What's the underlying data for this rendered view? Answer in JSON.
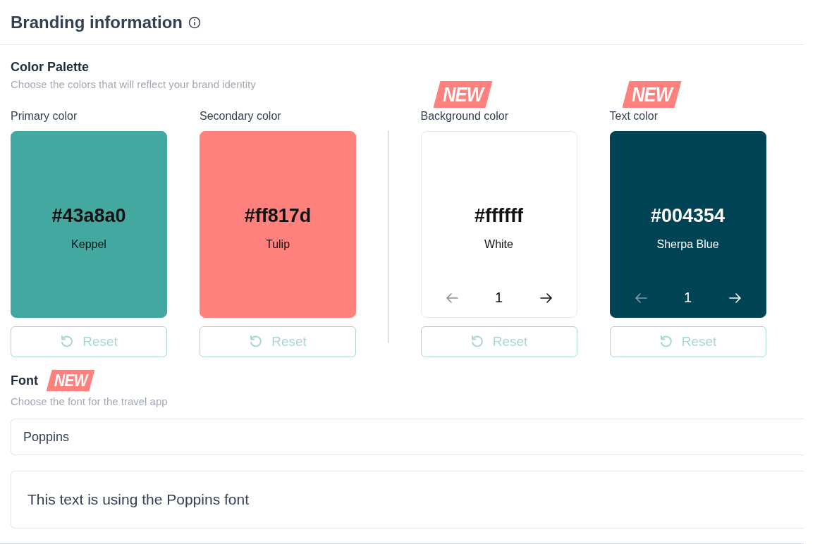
{
  "header": {
    "title": "Branding information"
  },
  "palette": {
    "title": "Color Palette",
    "subtitle": "Choose the colors that will reflect your brand identity",
    "groups": [
      {
        "swatches": [
          {
            "label": "Primary color",
            "hex": "#43a8a0",
            "name": "Keppel",
            "color": "#43a8a0",
            "kind": "plain",
            "reset": "Reset"
          },
          {
            "label": "Secondary color",
            "hex": "#ff817d",
            "name": "Tulip",
            "color": "#ff817d",
            "kind": "plain",
            "reset": "Reset"
          }
        ]
      },
      {
        "swatches": [
          {
            "label": "Background color",
            "badge": "NEW",
            "hex": "#ffffff",
            "name": "White",
            "color": "#ffffff",
            "kind": "paged",
            "page": "1",
            "prev_disabled": true,
            "reset": "Reset"
          },
          {
            "label": "Text color",
            "badge": "NEW",
            "hex": "#004354",
            "name": "Sherpa Blue",
            "color": "#004354",
            "kind": "paged",
            "page": "1",
            "prev_disabled": true,
            "reset": "Reset"
          }
        ]
      }
    ]
  },
  "font": {
    "title": "Font",
    "badge": "NEW",
    "subtitle": "Choose the font for the travel app",
    "value": "Poppins",
    "preview": "This text is using the Poppins font"
  }
}
